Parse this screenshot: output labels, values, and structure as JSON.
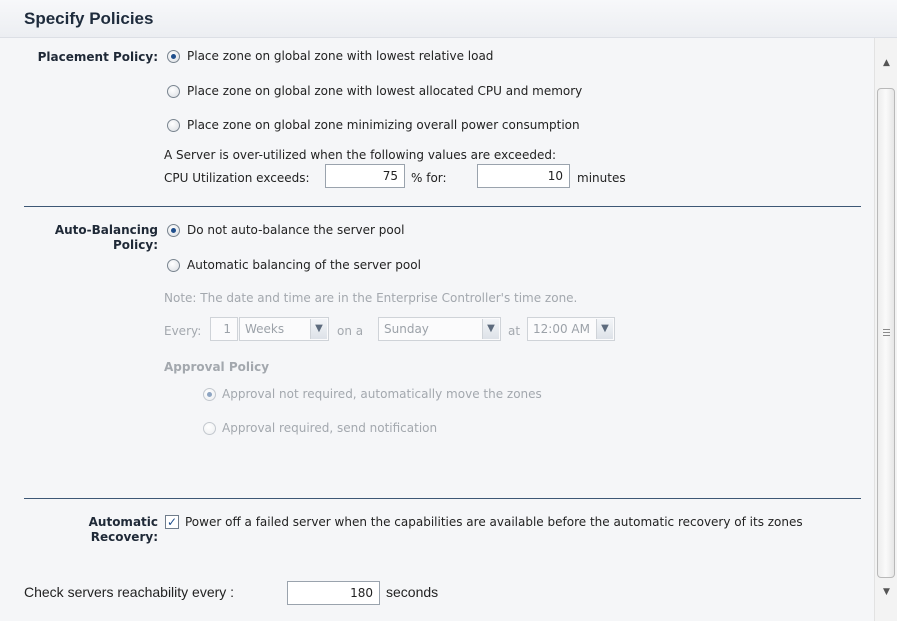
{
  "header": {
    "title": "Specify Policies"
  },
  "placement": {
    "label": "Placement Policy:",
    "options": [
      {
        "label": "Place zone on global zone with lowest relative load",
        "selected": true
      },
      {
        "label": "Place zone on global zone with lowest allocated CPU and memory",
        "selected": false
      },
      {
        "label": "Place zone on global zone minimizing overall power consumption",
        "selected": false
      }
    ],
    "overutil_text": "A Server is over-utilized when the following values are exceeded:",
    "cpu_label": "CPU Utilization exceeds:",
    "cpu_value": "75",
    "percent_for_label": "% for:",
    "minutes_value": "10",
    "minutes_label": "minutes"
  },
  "autobalance": {
    "label_line1": "Auto-Balancing",
    "label_line2": "Policy:",
    "options": [
      {
        "label": "Do not auto-balance the server pool",
        "selected": true
      },
      {
        "label": "Automatic balancing of the server pool",
        "selected": false
      }
    ],
    "note": "Note: The date and time are in the Enterprise Controller's time zone.",
    "every_label": "Every:",
    "every_value": "1",
    "period_value": "Weeks",
    "on_label": "on a",
    "day_value": "Sunday",
    "at_label": "at",
    "time_value": "12:00 AM",
    "approval_title": "Approval Policy",
    "approval_options": [
      {
        "label": "Approval not required, automatically move the zones",
        "selected": true
      },
      {
        "label": "Approval required, send notification",
        "selected": false
      }
    ]
  },
  "recovery": {
    "label_line1": "Automatic",
    "label_line2": "Recovery:",
    "checkbox_label": "Power off a failed server when the capabilities are available before the automatic recovery of its zones",
    "checked": true
  },
  "reachability": {
    "label": "Check servers reachability every :",
    "value": "180",
    "unit": "seconds"
  },
  "colors": {
    "accent": "#1f4e8c",
    "divider": "#3d5775",
    "disabled_text": "#a3a8ae"
  }
}
